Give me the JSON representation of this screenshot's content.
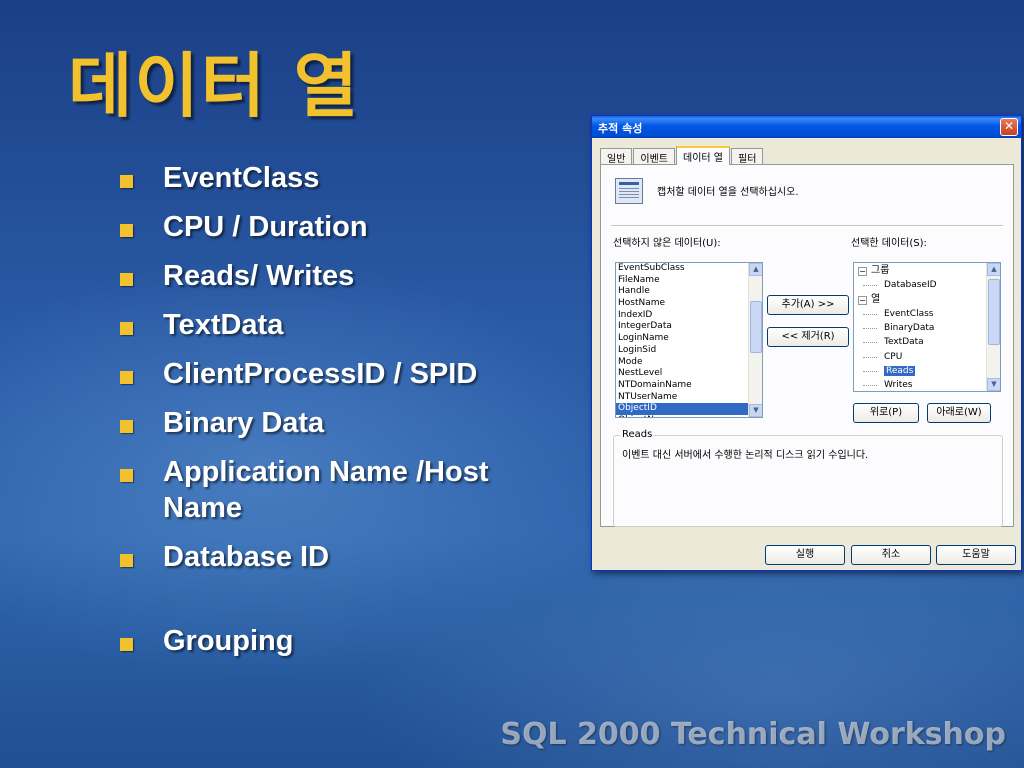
{
  "slide": {
    "title": "데이터 열",
    "bullets": [
      "EventClass",
      "CPU / Duration",
      "Reads/ Writes",
      "TextData",
      "ClientProcessID / SPID",
      "Binary Data",
      "Application Name /Host Name",
      "Database ID",
      "Grouping"
    ],
    "footer": "SQL 2000 Technical Workshop"
  },
  "dialog": {
    "title": "추적 속성",
    "tabs": [
      "일반",
      "이벤트",
      "데이터 열",
      "필터"
    ],
    "active_tab": "데이터 열",
    "description": "캡처할 데이터 열을 선택하십시오.",
    "unselected_label": "선택하지 않은 데이터(U):",
    "selected_label": "선택한 데이터(S):",
    "unselected_items": [
      "EventSubClass",
      "FileName",
      "Handle",
      "HostName",
      "IndexID",
      "IntegerData",
      "LoginName",
      "LoginSid",
      "Mode",
      "NestLevel",
      "NTDomainName",
      "NTUserName",
      "ObjectID",
      "ObjectName"
    ],
    "unselected_selected_item": "ObjectID",
    "add_button": "추가(A) >>",
    "remove_button": "<< 제거(R)",
    "tree": {
      "group1": "그룹",
      "group1_items": [
        "DatabaseID"
      ],
      "group2": "열",
      "group2_items": [
        "EventClass",
        "BinaryData",
        "TextData",
        "CPU",
        "Reads",
        "Writes"
      ],
      "selected_item": "Reads"
    },
    "up_button": "위로(P)",
    "down_button": "아래로(W)",
    "info_legend": "Reads",
    "info_text": "이벤트 대신 서버에서 수행한 논리적 디스크 읽기 수입니다.",
    "run_button": "실행",
    "cancel_button": "취소",
    "help_button": "도움말"
  }
}
